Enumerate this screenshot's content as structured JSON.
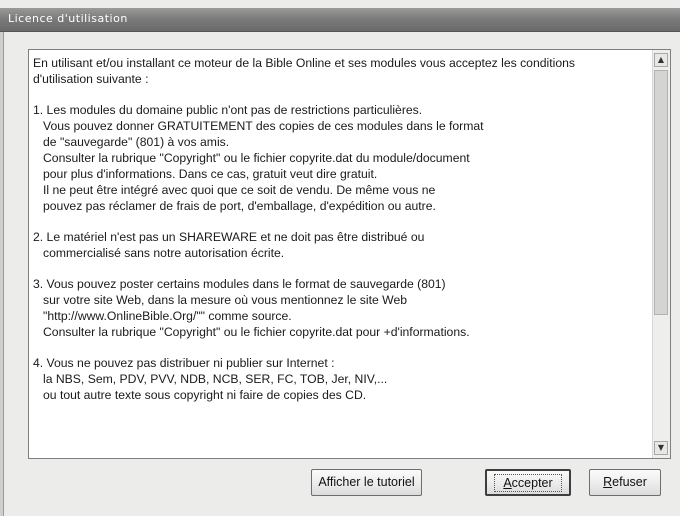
{
  "window": {
    "title": "Licence d'utilisation"
  },
  "license": {
    "intro": [
      "En utilisant et/ou installant ce moteur de la Bible Online et ses modules vous acceptez les conditions",
      "d'utilisation suivante :"
    ],
    "sections": [
      {
        "lines": [
          "1. Les modules du domaine public n'ont pas de restrictions particulières.",
          "Vous pouvez donner GRATUITEMENT des copies de ces modules dans le format",
          "de \"sauvegarde\" (801) à vos amis.",
          "Consulter la rubrique \"Copyright\" ou le fichier copyrite.dat du module/document",
          "pour plus d'informations. Dans ce cas, gratuit veut dire gratuit.",
          "Il ne peut être intégré avec quoi que ce soit de vendu. De même vous ne",
          "pouvez pas  réclamer de frais de port, d'emballage, d'expédition ou autre."
        ]
      },
      {
        "lines": [
          "2. Le matériel n'est pas un SHAREWARE et ne doit pas être distribué ou",
          "commercialisé sans notre autorisation écrite."
        ]
      },
      {
        "lines": [
          "3. Vous pouvez poster certains modules dans le format de sauvegarde (801)",
          "sur votre site Web, dans la mesure où vous mentionnez le site Web",
          "\"http://www.OnlineBible.Org/\"\" comme source.",
          "Consulter la rubrique \"Copyright\" ou le fichier copyrite.dat pour +d'informations."
        ]
      },
      {
        "lines": [
          "4. Vous ne pouvez pas distribuer ni publier sur Internet :",
          "la NBS, Sem, PDV, PVV, NDB, NCB, SER, FC, TOB, Jer, NIV,...",
          "ou tout autre texte sous copyright ni faire de copies des CD."
        ]
      }
    ]
  },
  "buttons": {
    "tutorial": "Afficher le tutoriel",
    "accept_first": "A",
    "accept_rest": "ccepter",
    "refuse_first": "R",
    "refuse_rest": "efuser"
  },
  "icons": {
    "scroll_up": "scroll-up-arrow",
    "scroll_down": "scroll-down-arrow"
  }
}
